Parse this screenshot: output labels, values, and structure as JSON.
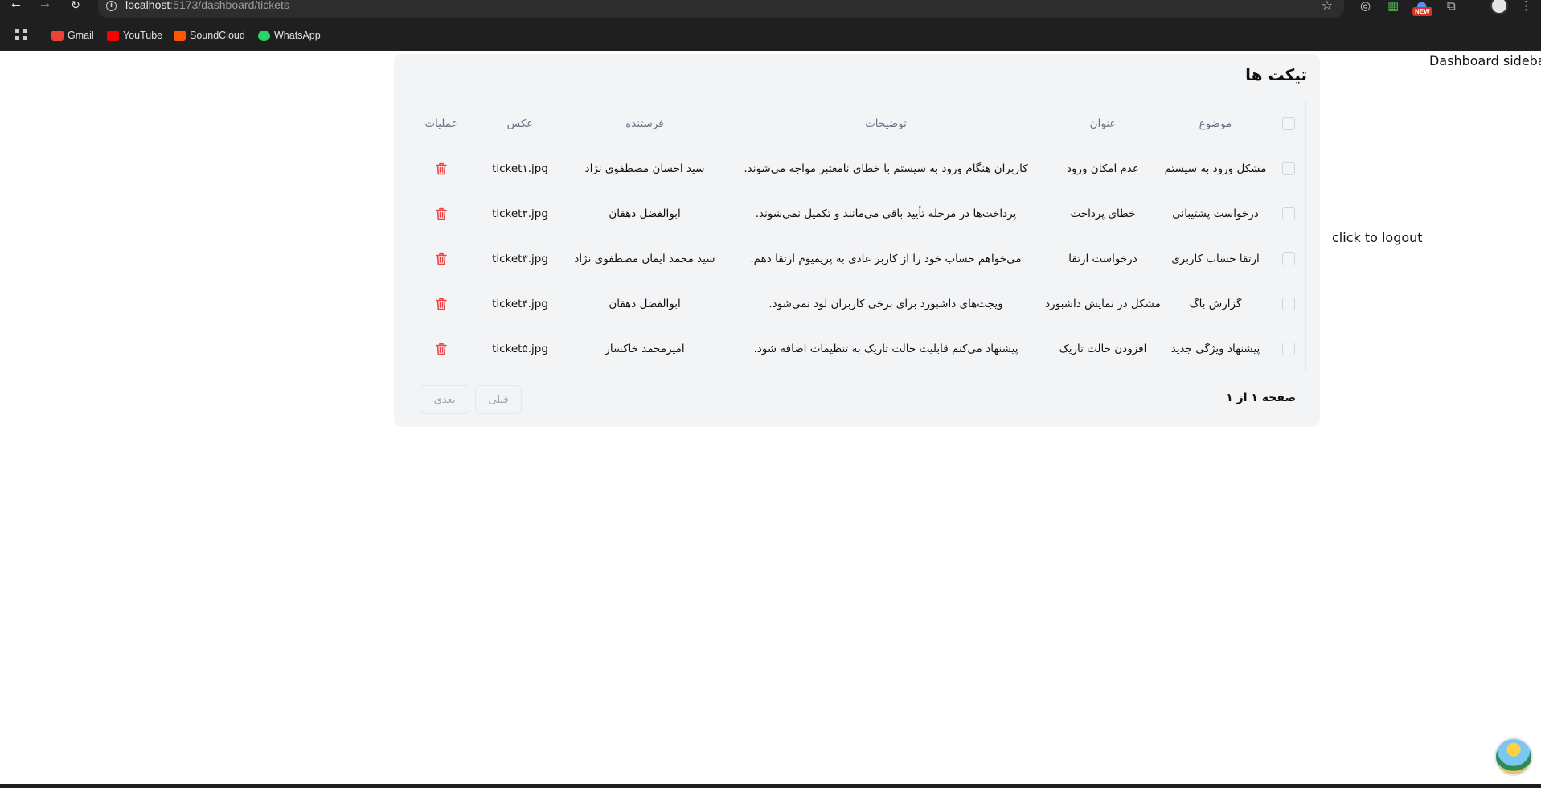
{
  "browser": {
    "url_host": "localhost",
    "url_path": ":5173/dashboard/tickets",
    "new_badge": "NEW",
    "bookmarks": [
      {
        "label": "Gmail",
        "color": "#ea4335"
      },
      {
        "label": "YouTube",
        "color": "#ff0000"
      },
      {
        "label": "SoundCloud",
        "color": "#ff5500"
      },
      {
        "label": "WhatsApp",
        "color": "#25d366"
      }
    ]
  },
  "sidebar": {
    "label": "Dashboard sidebar",
    "logout_label": "click to logout"
  },
  "tickets": {
    "title": "تیکت ها",
    "columns": {
      "subject": "موضوع",
      "title": "عنوان",
      "description": "توضیحات",
      "sender": "فرستنده",
      "image": "عکس",
      "actions": "عملیات"
    },
    "rows": [
      {
        "subject": "مشکل ورود به سیستم",
        "title": "عدم امکان ورود",
        "description": "کاربران هنگام ورود به سیستم با خطای نامعتبر مواجه می‌شوند.",
        "sender": "سید احسان مصطفوی نژاد",
        "image": "ticket۱.jpg"
      },
      {
        "subject": "درخواست پشتیبانی",
        "title": "خطای پرداخت",
        "description": "پرداخت‌ها در مرحله تأیید باقی می‌مانند و تکمیل نمی‌شوند.",
        "sender": "ابوالفضل دهقان",
        "image": "ticket۲.jpg"
      },
      {
        "subject": "ارتقا حساب کاربری",
        "title": "درخواست ارتقا",
        "description": "می‌خواهم حساب خود را از کاربر عادی به پریمیوم ارتقا دهم.",
        "sender": "سید محمد ایمان مصطفوی نژاد",
        "image": "ticket۳.jpg"
      },
      {
        "subject": "گزارش باگ",
        "title": "مشکل در نمایش داشبورد",
        "description": "ویجت‌های داشبورد برای برخی کاربران لود نمی‌شود.",
        "sender": "ابوالفضل دهقان",
        "image": "ticket۴.jpg"
      },
      {
        "subject": "پیشنهاد ویژگی جدید",
        "title": "افزودن حالت تاریک",
        "description": "پیشنهاد می‌کنم قابلیت حالت تاریک به تنظیمات اضافه شود.",
        "sender": "امیرمحمد خاکسار",
        "image": "ticket۵.jpg"
      }
    ],
    "pagination": {
      "info": "صفحه ۱ از ۱",
      "prev_label": "قبلی",
      "next_label": "بعدی"
    },
    "delete_icon_color": "#ef4444"
  }
}
